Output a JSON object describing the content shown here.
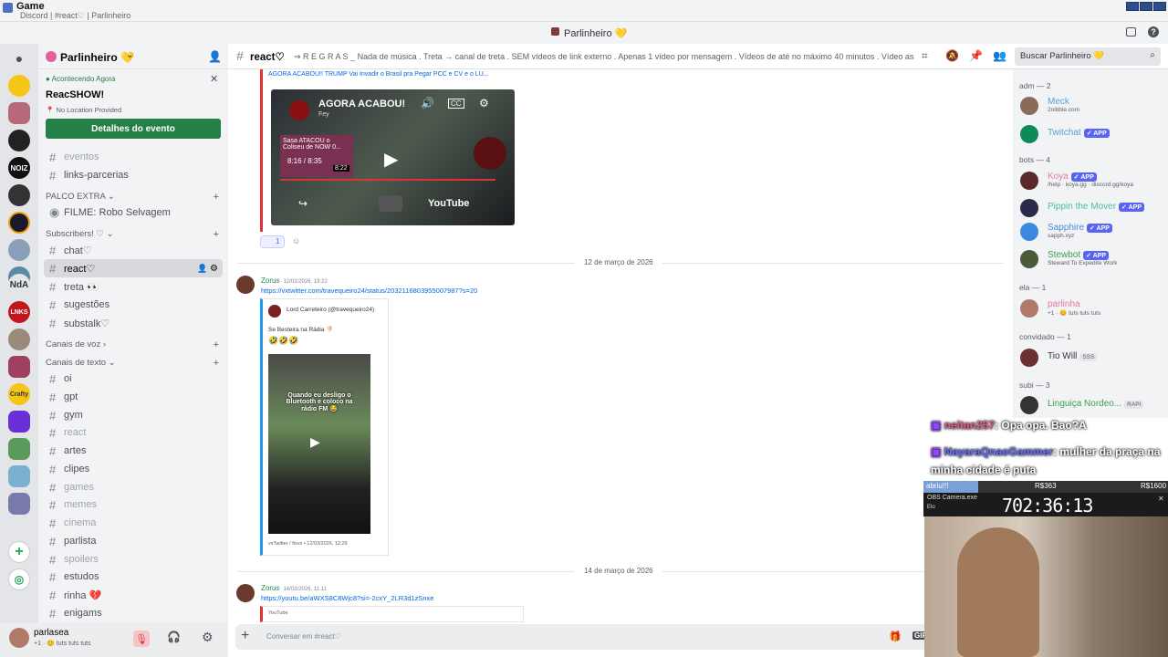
{
  "os": {
    "app_title": "Game",
    "window_subtitle": "Discord | #react♡ | Parlinheiro"
  },
  "titlebar": {
    "title": "Parlinheiro 💛"
  },
  "server": {
    "name": "Parlinheiro 💛"
  },
  "event": {
    "status": "Acontecendo Agora",
    "name": "ReacSHOW!",
    "location": "No Location Provided",
    "button": "Detalhes do evento"
  },
  "channels": [
    {
      "label": "eventos",
      "muted": true
    },
    {
      "label": "links-parcerias",
      "muted": false
    }
  ],
  "categories": {
    "palco": "PALCO EXTRA",
    "subscribers": "Subscribers! ♡",
    "voz": "Canais de voz",
    "texto": "Canais de texto"
  },
  "stage_channel": "FILME: Robo Selvagem",
  "sub_channels": [
    {
      "label": "chat♡",
      "selected": false,
      "muted": false
    },
    {
      "label": "react♡",
      "selected": true,
      "muted": false
    },
    {
      "label": "treta 👀",
      "selected": false,
      "muted": false
    },
    {
      "label": "sugestões",
      "selected": false,
      "muted": false
    },
    {
      "label": "substalk♡",
      "selected": false,
      "muted": false
    }
  ],
  "text_channels": [
    {
      "label": "oi",
      "muted": false
    },
    {
      "label": "gpt",
      "muted": false
    },
    {
      "label": "gym",
      "muted": false
    },
    {
      "label": "react",
      "muted": true
    },
    {
      "label": "artes",
      "muted": false
    },
    {
      "label": "clipes",
      "muted": false
    },
    {
      "label": "games",
      "muted": true
    },
    {
      "label": "memes",
      "muted": true
    },
    {
      "label": "cinema",
      "muted": true
    },
    {
      "label": "parlista",
      "muted": false
    },
    {
      "label": "spoilers",
      "muted": true
    },
    {
      "label": "estudos",
      "muted": false
    },
    {
      "label": "rinha 💔",
      "muted": false
    },
    {
      "label": "enigams",
      "muted": false
    }
  ],
  "user": {
    "name": "parlasea",
    "status": "+1 · 😊 tuts tuts tuts"
  },
  "header": {
    "channel": "react♡",
    "topic": "⇒ R E G R A S _ Nada de música . Treta → canal de treta . SEM vídeos de link externo . Apenas 1 vídeo por mensagem . Vídeos de até no máximo 40 minutos . Vídeo assusta...",
    "search_placeholder": "Buscar Parlinheiro 💛"
  },
  "messages": {
    "top_embed_title": "AGORA ACABOU!! TRUMP Vai Invadir o Brasil pra Pegar PCC e CV e o LU...",
    "video_title": "AGORA ACABOU!",
    "video_channel": "Fey",
    "video_inner_title": "Sasa ATACOU o Coliseu de NOW 0...",
    "video_time": "8:16 / 8:35",
    "video_duration": "8:22",
    "youtube_label": "YouTube",
    "reaction_count": "1",
    "date1": "12 de março de 2026",
    "msg1_author": "Zorus",
    "msg1_time": "12/03/2026, 19:22",
    "msg1_link": "https://vxtwitter.com/travequeiro24/status/2032116803955007987?s=20",
    "tweet_author": "Lord Carreteiro (@travequeiro24)",
    "tweet_text": "Se Besteira na Rádia 👎🏻",
    "tweet_emojis": "🤣🤣🤣",
    "tweet_caption": "Quando eu desligo o Bluetooth e coloco na rádio FM 😂",
    "tweet_footer": "vxTwitter / fixvx • 12/03/2026, 12:29",
    "date2": "14 de março de 2026",
    "msg2_author": "Zorus",
    "msg2_time": "14/03/2026, 11:11",
    "msg2_link": "https://youtu.be/aWXS8C8Wjc8?si=-2cxY_2LR3d1zSnxe",
    "msg2_embed": "YouTube"
  },
  "composer": {
    "placeholder": "Conversar em #react♡"
  },
  "members": {
    "groups": [
      {
        "label": "adm — 2"
      },
      {
        "label": "bots — 4"
      },
      {
        "label": "ela — 1"
      },
      {
        "label": "convidado — 1"
      },
      {
        "label": "subi — 3"
      }
    ],
    "list": [
      {
        "name": "Meck",
        "sub": "2nibble.com",
        "app": false
      },
      {
        "name": "Twitchat",
        "sub": "",
        "app": true
      },
      {
        "name": "Koya",
        "sub": "/help · koya.gg · discord.gg/koya",
        "app": true
      },
      {
        "name": "Pippin the Mover",
        "sub": "",
        "app": true
      },
      {
        "name": "Sapphire",
        "sub": "sapph.xyz",
        "app": true
      },
      {
        "name": "Stewbot",
        "sub": "Steward To Expedite Work",
        "app": true
      },
      {
        "name": "parlinha",
        "sub": "+1 · 😊 tuts tuts tuts",
        "app": false
      },
      {
        "name": "Tio Will",
        "sub": "",
        "app": false
      },
      {
        "name": "Linguiça Nordeo...",
        "sub": "",
        "app": false
      }
    ],
    "app_tag": "✓ APP",
    "sss_tag": "SSS",
    "rap_tag": "RAPI"
  },
  "overlay": {
    "chat": [
      {
        "user": "neitan257",
        "text": ": Opa opa. Bao?A"
      },
      {
        "user": "NayaraQnaoGammer",
        "text": ": mulher da praça na minha cidade é puta"
      }
    ],
    "subbar_label": "abriu!!!",
    "subbar_mid": "R$363",
    "subbar_right": "R$1600",
    "camera_label": "OBS Camera.exe",
    "camera_sub": "Elo",
    "timer": "702:36:13"
  },
  "colors": {
    "accent": "#5865f2",
    "green": "#248046",
    "link": "#0068e0",
    "youtube_red": "#e0303a"
  }
}
